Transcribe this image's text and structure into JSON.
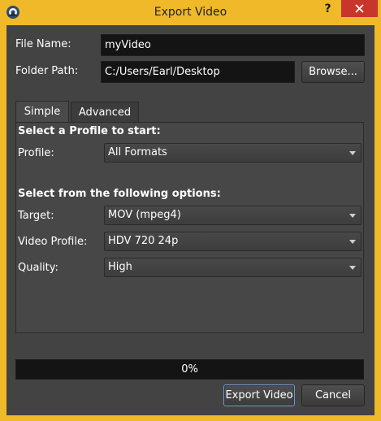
{
  "window": {
    "title": "Export Video",
    "help_label": "?",
    "accent_color": "#f0b929",
    "close_color": "#c7352b"
  },
  "form": {
    "file_name_label": "File Name:",
    "file_name_value": "myVideo",
    "folder_path_label": "Folder Path:",
    "folder_path_value": "C:/Users/Earl/Desktop",
    "browse_label": "Browse..."
  },
  "tabs": [
    {
      "label": "Simple",
      "active": true
    },
    {
      "label": "Advanced",
      "active": false
    }
  ],
  "simple": {
    "profile_heading": "Select a Profile to start:",
    "profile_label": "Profile:",
    "profile_value": "All Formats",
    "options_heading": "Select from the following options:",
    "target_label": "Target:",
    "target_value": "MOV (mpeg4)",
    "video_profile_label": "Video Profile:",
    "video_profile_value": "HDV 720 24p",
    "quality_label": "Quality:",
    "quality_value": "High"
  },
  "progress": {
    "text": "0%",
    "fraction": 0
  },
  "actions": {
    "export_label": "Export Video",
    "cancel_label": "Cancel"
  }
}
